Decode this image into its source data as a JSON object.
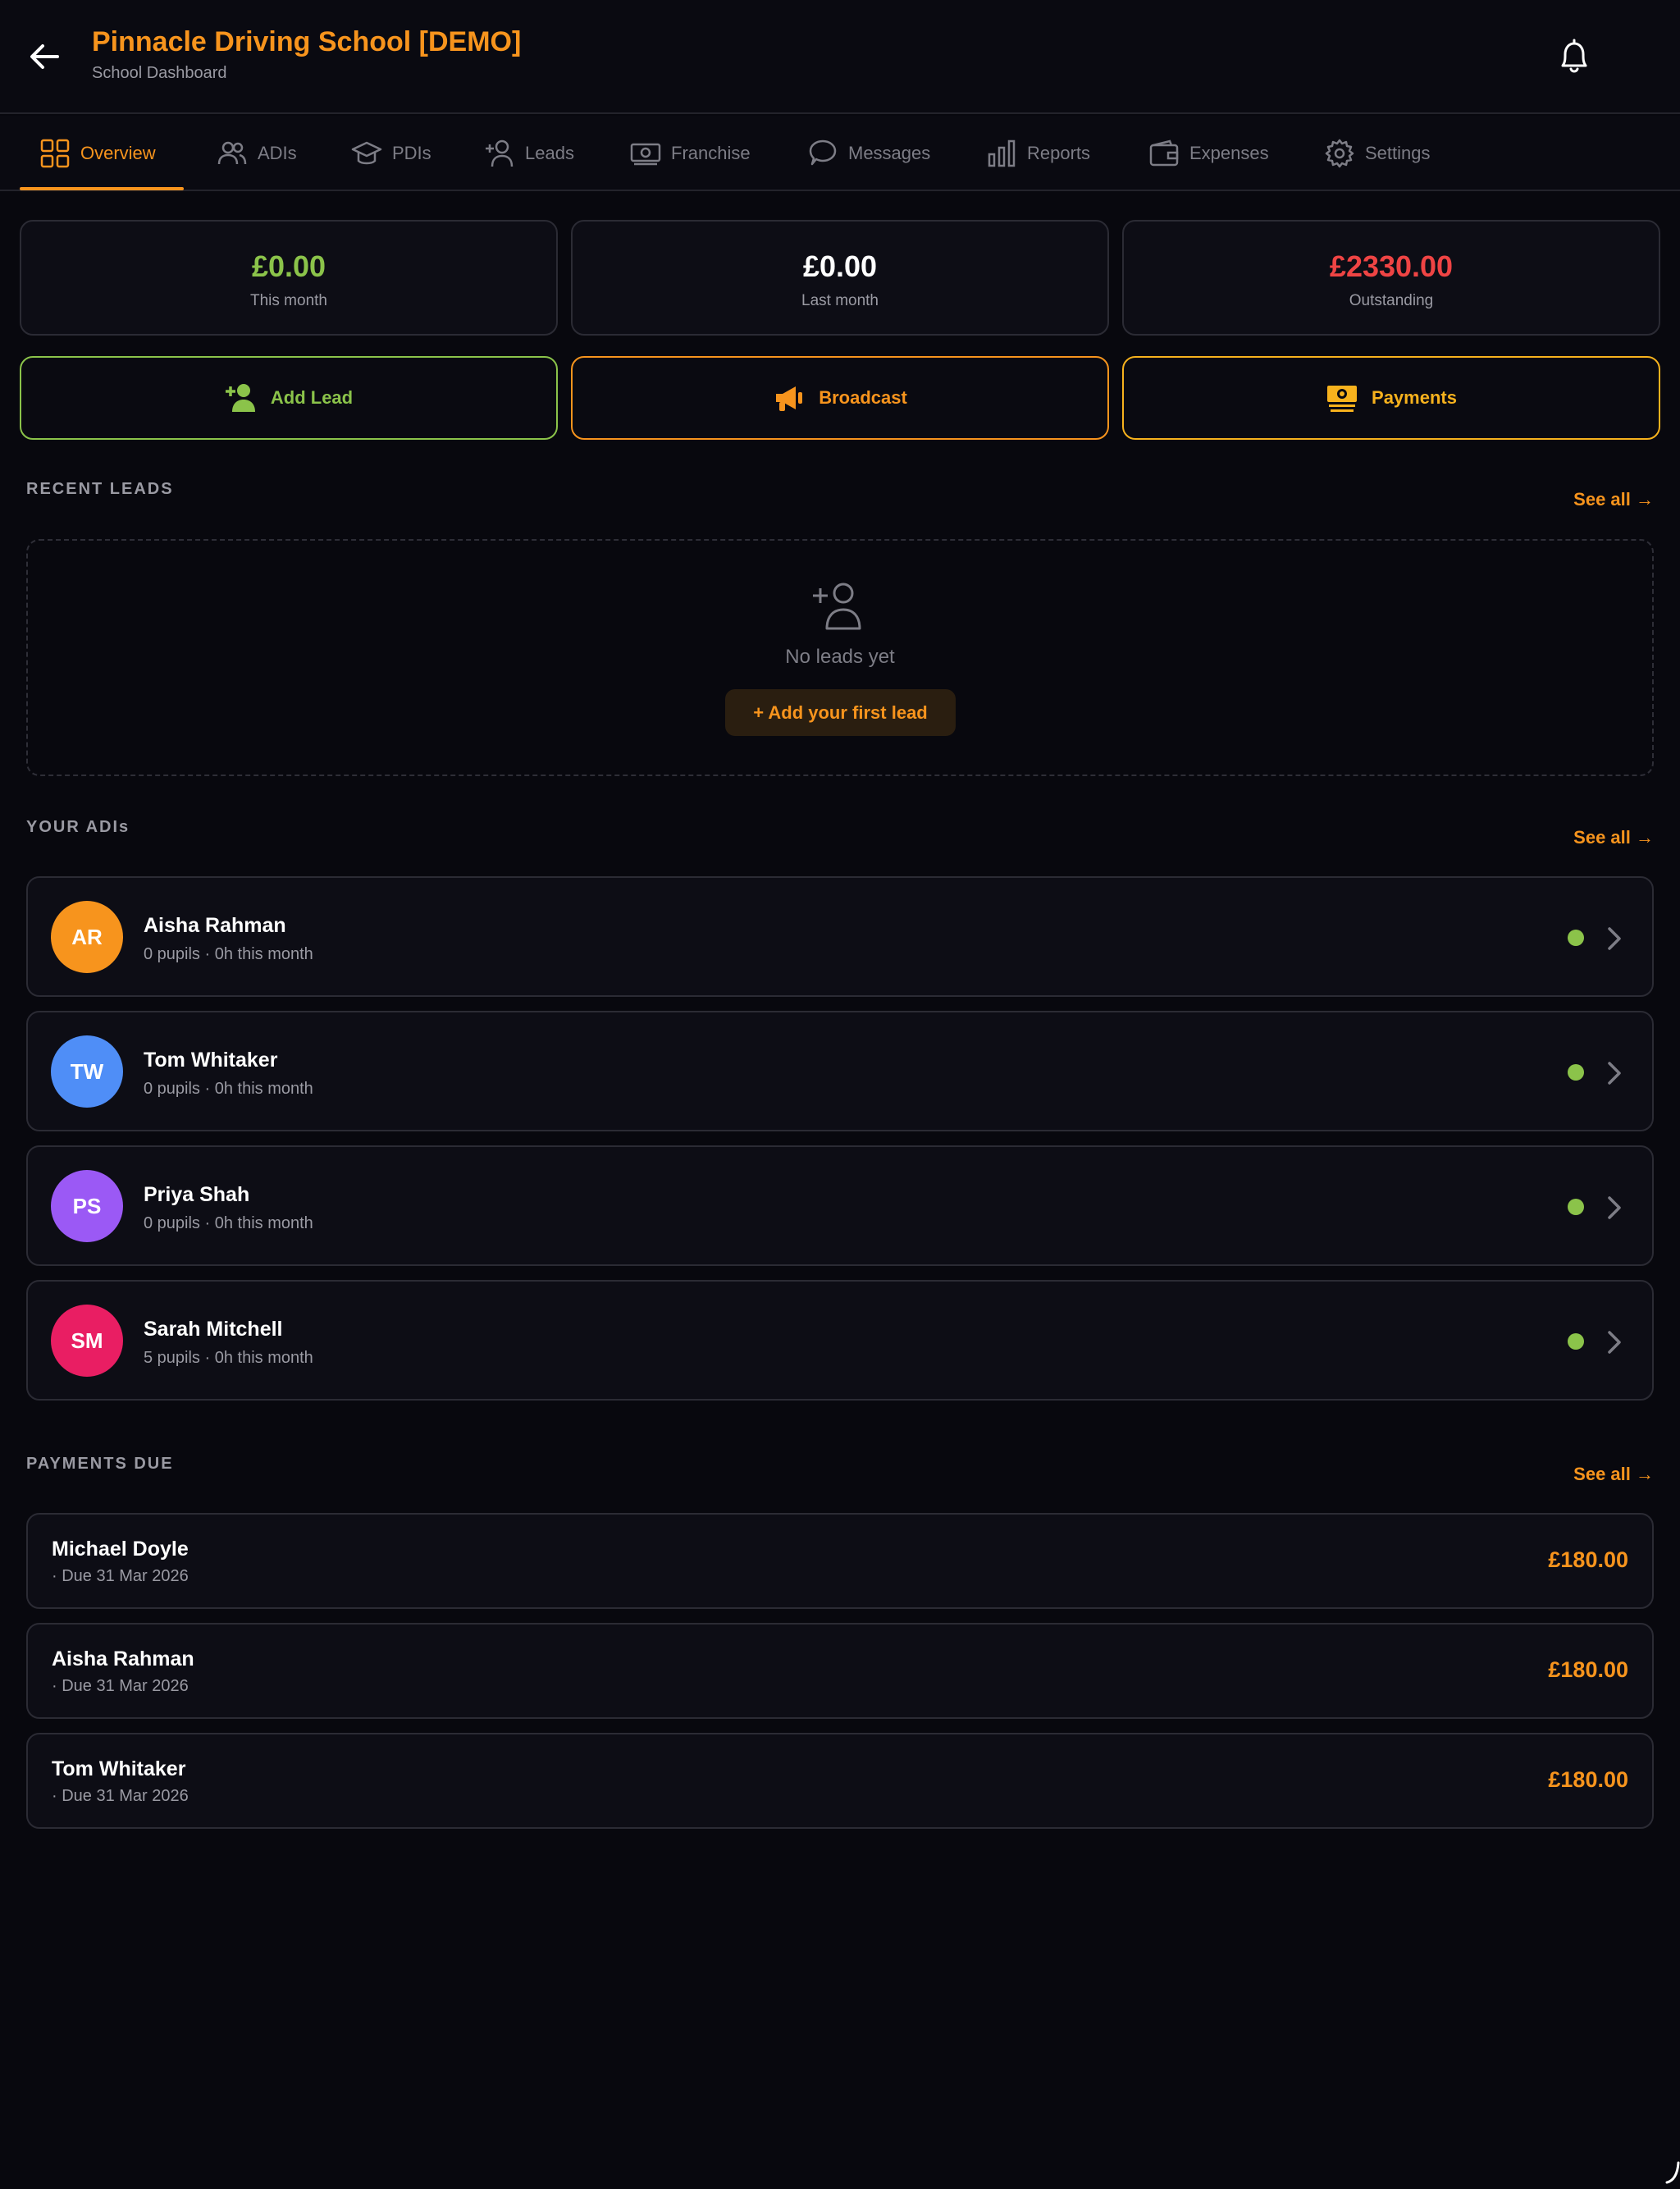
{
  "header": {
    "title": "Pinnacle Driving School [DEMO]",
    "subtitle": "School Dashboard",
    "back_icon": "arrow-left-icon",
    "bell_icon": "bell-icon"
  },
  "tabs": [
    {
      "label": "Overview",
      "icon": "grid-icon",
      "active": true
    },
    {
      "label": "ADIs",
      "icon": "users-icon"
    },
    {
      "label": "PDIs",
      "icon": "graduation-cap-icon"
    },
    {
      "label": "Leads",
      "icon": "user-plus-icon"
    },
    {
      "label": "Franchise",
      "icon": "banknote-icon"
    },
    {
      "label": "Messages",
      "icon": "chat-bubble-icon"
    },
    {
      "label": "Reports",
      "icon": "bar-chart-icon"
    },
    {
      "label": "Expenses",
      "icon": "wallet-icon"
    },
    {
      "label": "Settings",
      "icon": "gear-icon"
    }
  ],
  "stats": [
    {
      "value": "£0.00",
      "label": "This month",
      "color": "#8bc34a"
    },
    {
      "value": "£0.00",
      "label": "Last month",
      "color": "#ffffff"
    },
    {
      "value": "£2330.00",
      "label": "Outstanding",
      "color": "#ef4444"
    }
  ],
  "actions": [
    {
      "label": "Add Lead",
      "icon": "user-plus-icon",
      "color": "#8bc34a"
    },
    {
      "label": "Broadcast",
      "icon": "megaphone-icon",
      "color": "#f7941d"
    },
    {
      "label": "Payments",
      "icon": "money-stack-icon",
      "color": "#f7b21d"
    }
  ],
  "recent_leads": {
    "title": "RECENT LEADS",
    "see_all": "See all →",
    "empty_text": "No leads yet",
    "add_first": "+ Add your first lead"
  },
  "adis": {
    "title": "YOUR ADIs",
    "see_all": "See all →",
    "items": [
      {
        "initials": "AR",
        "name": "Aisha Rahman",
        "meta": "0 pupils · 0h this month",
        "avatar_color": "#f7941d"
      },
      {
        "initials": "TW",
        "name": "Tom Whitaker",
        "meta": "0 pupils · 0h this month",
        "avatar_color": "#4f8ef7"
      },
      {
        "initials": "PS",
        "name": "Priya Shah",
        "meta": "0 pupils · 0h this month",
        "avatar_color": "#9b59f5"
      },
      {
        "initials": "SM",
        "name": "Sarah Mitchell",
        "meta": "5 pupils · 0h this month",
        "avatar_color": "#e91e63"
      }
    ]
  },
  "payments": {
    "title": "PAYMENTS DUE",
    "see_all": "See all →",
    "items": [
      {
        "name": "Michael Doyle",
        "due": "· Due 31 Mar 2026",
        "amount": "£180.00"
      },
      {
        "name": "Aisha Rahman",
        "due": "· Due 31 Mar 2026",
        "amount": "£180.00"
      },
      {
        "name": "Tom Whitaker",
        "due": "· Due 31 Mar 2026",
        "amount": "£180.00"
      }
    ]
  },
  "colors": {
    "accent": "#f7941d",
    "background": "#08080e",
    "status_active": "#8bc34a"
  }
}
